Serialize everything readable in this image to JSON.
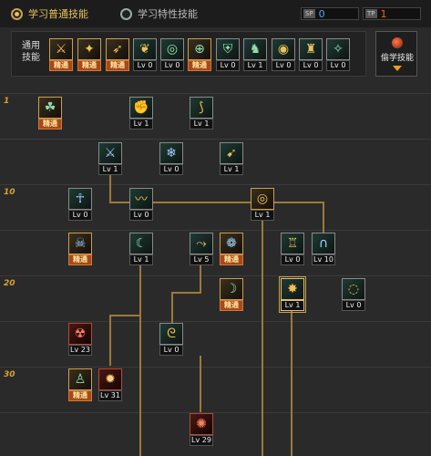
{
  "tabs": [
    {
      "label": "学习普通技能",
      "selected": true
    },
    {
      "label": "学习特性技能",
      "selected": false
    }
  ],
  "points": [
    {
      "tag": "SP",
      "value": "0",
      "color": "#4aa8ff"
    },
    {
      "tag": "TP",
      "value": "1",
      "color": "#ff5a3a"
    }
  ],
  "common_skills": {
    "label": "通用技能",
    "items": [
      {
        "icon": "quick-rebound-icon",
        "level": "精通"
      },
      {
        "icon": "leap-icon",
        "level": "精通"
      },
      {
        "icon": "backstep-icon",
        "level": "精通"
      },
      {
        "icon": "wings-icon",
        "level": "Lv 0"
      },
      {
        "icon": "target-icon",
        "level": "Lv 0"
      },
      {
        "icon": "crosshair-icon",
        "level": "精通"
      },
      {
        "icon": "armor-icon",
        "level": "Lv 0"
      },
      {
        "icon": "runner-icon",
        "level": "Lv 1"
      },
      {
        "icon": "eye-icon",
        "level": "Lv 0"
      },
      {
        "icon": "strength-icon",
        "level": "Lv 0"
      },
      {
        "icon": "kick-icon",
        "level": "Lv 0"
      }
    ],
    "steal_label": "偷学技能"
  },
  "tree": {
    "row_labels": [
      "1",
      "10",
      "20",
      "30"
    ],
    "skills": [
      {
        "id": "s1",
        "icon": "wind-slash-icon",
        "level": "精通"
      },
      {
        "id": "s2",
        "icon": "flame-fist-icon",
        "level": "Lv 1"
      },
      {
        "id": "s3",
        "icon": "claw-icon",
        "level": "Lv 1"
      },
      {
        "id": "s4",
        "icon": "sword-icon",
        "level": "Lv 1"
      },
      {
        "id": "s5",
        "icon": "ice-dash-icon",
        "level": "Lv 0"
      },
      {
        "id": "s6",
        "icon": "rising-kick-icon",
        "level": "Lv 1"
      },
      {
        "id": "s7",
        "icon": "ankh-icon",
        "level": "Lv 0"
      },
      {
        "id": "s8",
        "icon": "wind-blade-icon",
        "level": "Lv 0"
      },
      {
        "id": "s9",
        "icon": "vortex-icon",
        "level": "Lv 1"
      },
      {
        "id": "s10",
        "icon": "demon-mask-icon",
        "level": "精通"
      },
      {
        "id": "s11",
        "icon": "green-slash-icon",
        "level": "Lv 1"
      },
      {
        "id": "s12",
        "icon": "golden-swipe-icon",
        "level": "Lv 5"
      },
      {
        "id": "s13",
        "icon": "whirl-icon",
        "level": "精通"
      },
      {
        "id": "s14",
        "icon": "tower-icon",
        "level": "Lv 0"
      },
      {
        "id": "s15",
        "icon": "arc-wave-icon",
        "level": "Lv 10"
      },
      {
        "id": "s16",
        "icon": "crescent-icon",
        "level": "精通"
      },
      {
        "id": "s17",
        "icon": "burst-icon",
        "level": "Lv 1"
      },
      {
        "id": "s18",
        "icon": "spiral-icon",
        "level": "Lv 0"
      },
      {
        "id": "s19",
        "icon": "fire-demon-icon",
        "level": "Lv 23"
      },
      {
        "id": "s20",
        "icon": "fire-tornado-icon",
        "level": "Lv 0"
      },
      {
        "id": "s21",
        "icon": "awakened-icon",
        "level": "精通"
      },
      {
        "id": "s22",
        "icon": "explosion-icon",
        "level": "Lv 31"
      },
      {
        "id": "s23",
        "icon": "inferno-icon",
        "level": "Lv 29"
      }
    ]
  }
}
